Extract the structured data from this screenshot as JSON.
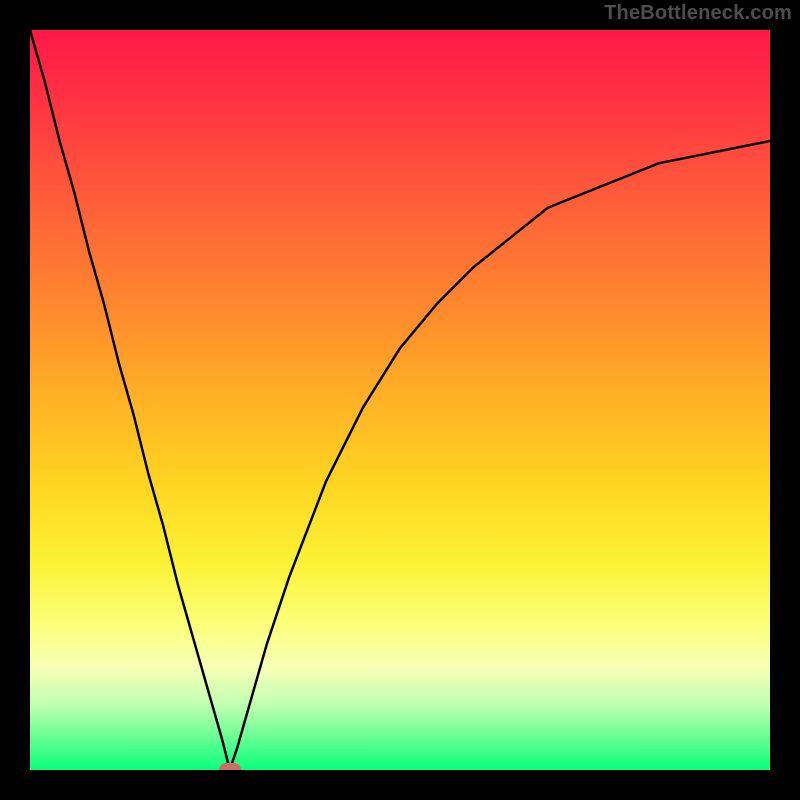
{
  "watermark": "TheBottleneck.com",
  "chart_data": {
    "type": "line",
    "title": "",
    "xlabel": "",
    "ylabel": "",
    "xlim": [
      0,
      100
    ],
    "ylim": [
      0,
      100
    ],
    "grid": false,
    "legend": false,
    "x": [
      0,
      2,
      4,
      6,
      8,
      10,
      12,
      14,
      16,
      18,
      20,
      22,
      24,
      26,
      27,
      28,
      30,
      32,
      35,
      40,
      45,
      50,
      55,
      60,
      65,
      70,
      75,
      80,
      85,
      90,
      95,
      100
    ],
    "y": [
      100,
      93,
      85,
      78,
      70,
      63,
      55,
      48,
      40,
      33,
      25,
      18,
      11,
      4,
      0,
      3,
      10,
      17,
      26,
      39,
      49,
      57,
      63,
      68,
      72,
      76,
      78,
      80,
      82,
      83,
      84,
      85
    ],
    "marker": {
      "x": 27,
      "y": 0
    },
    "background_gradient": [
      "#ff1847",
      "#ff5a3a",
      "#ff8a2e",
      "#ffd722",
      "#fbff77",
      "#09ff7e"
    ]
  }
}
